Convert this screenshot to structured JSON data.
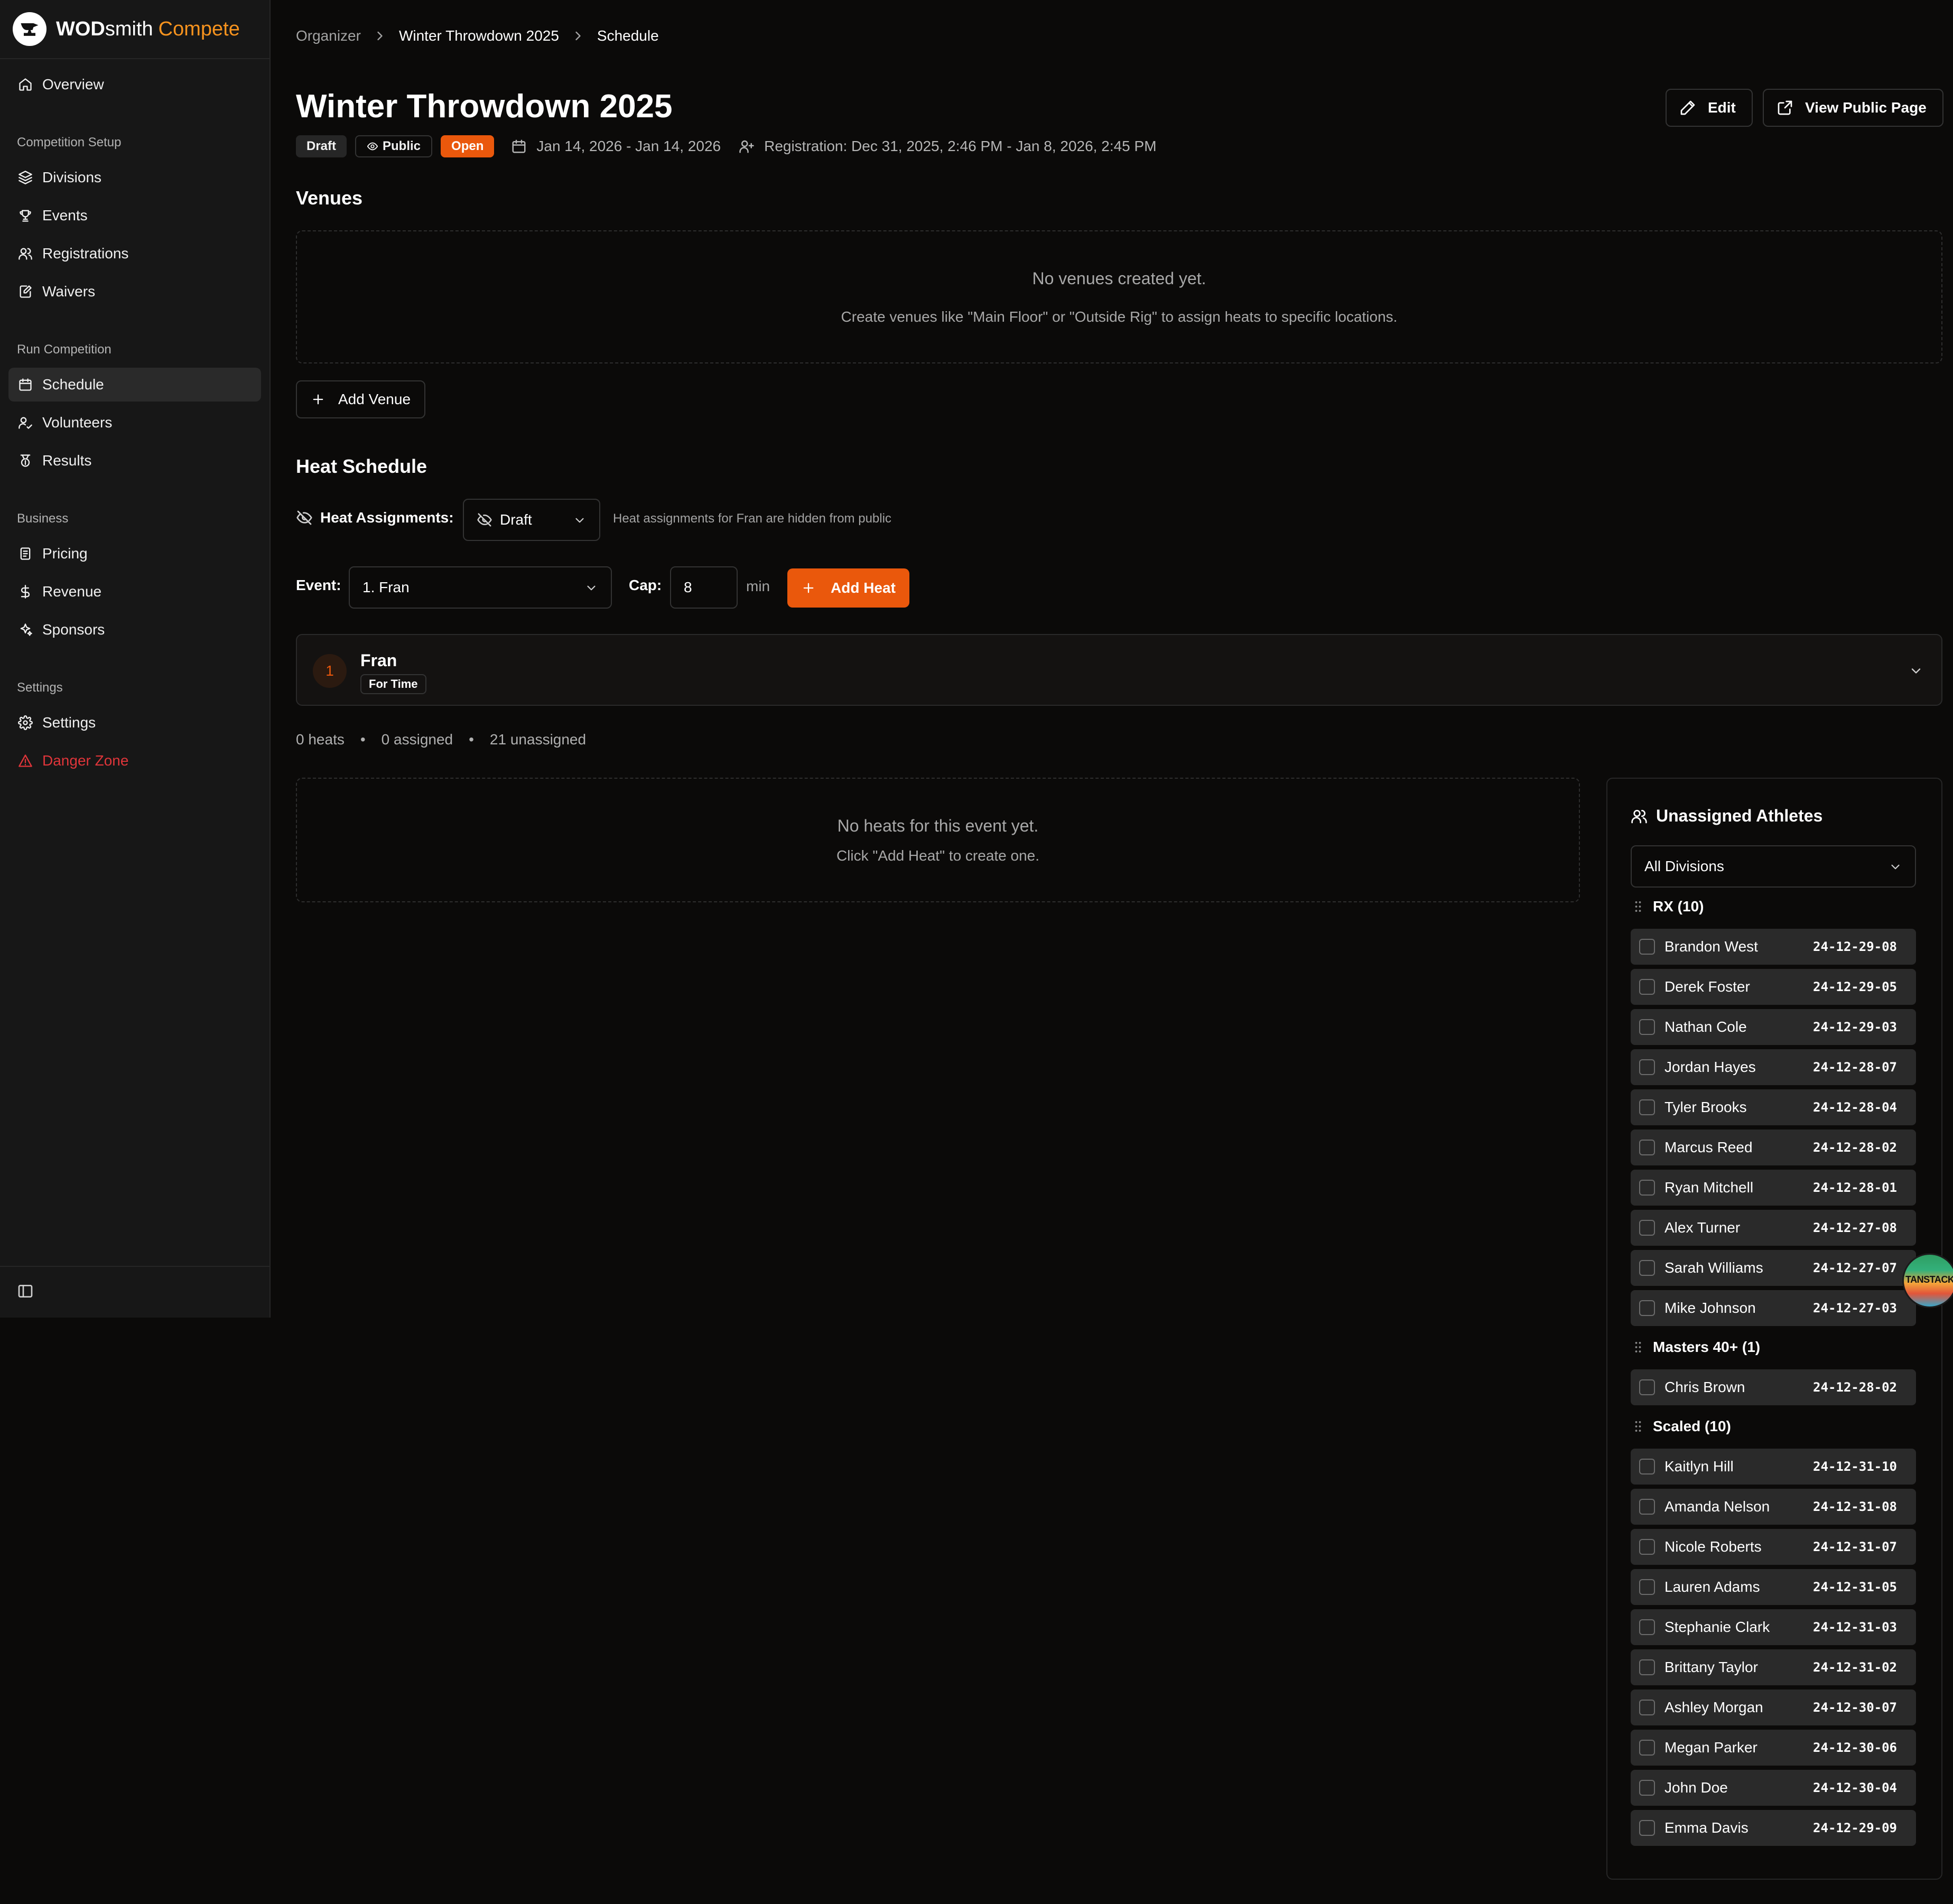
{
  "brand": {
    "name_bold": "WOD",
    "name_light": "smith",
    "name_accent": "Compete"
  },
  "sidebar": {
    "overview": "Overview",
    "sections": {
      "setup": "Competition Setup",
      "run": "Run Competition",
      "business": "Business",
      "settings": "Settings"
    },
    "items": {
      "divisions": "Divisions",
      "events": "Events",
      "registrations": "Registrations",
      "waivers": "Waivers",
      "schedule": "Schedule",
      "volunteers": "Volunteers",
      "results": "Results",
      "pricing": "Pricing",
      "revenue": "Revenue",
      "sponsors": "Sponsors",
      "settings": "Settings",
      "danger": "Danger Zone"
    },
    "active_item": "schedule"
  },
  "breadcrumb": [
    "Organizer",
    "Winter Throwdown 2025",
    "Schedule"
  ],
  "header": {
    "title": "Winter Throwdown 2025",
    "edit_label": "Edit",
    "view_public_label": "View Public Page",
    "badges": {
      "draft": "Draft",
      "public": "Public",
      "open": "Open"
    },
    "dates": "Jan 14, 2026 - Jan 14, 2026",
    "registration": "Registration: Dec 31, 2025, 2:46 PM - Jan 8, 2026, 2:45 PM"
  },
  "venues": {
    "title": "Venues",
    "empty_title": "No venues created yet.",
    "empty_sub": "Create venues like \"Main Floor\" or \"Outside Rig\" to assign heats to specific locations.",
    "add_label": "Add Venue"
  },
  "heat_schedule": {
    "title": "Heat Schedule",
    "assignments_label": "Heat Assignments:",
    "assignments_value": "Draft",
    "assignments_hint": "Heat assignments for Fran are hidden from public",
    "event_label": "Event:",
    "event_value": "1. Fran",
    "cap_label": "Cap:",
    "cap_value": "8",
    "cap_unit": "min",
    "add_heat_label": "Add Heat"
  },
  "event_card": {
    "number": "1",
    "name": "Fran",
    "scheme": "For Time"
  },
  "stats": {
    "heats": "0 heats",
    "assigned": "0 assigned",
    "unassigned": "21 unassigned",
    "separator": "•"
  },
  "heats_empty": {
    "title": "No heats for this event yet.",
    "sub": "Click \"Add Heat\" to create one."
  },
  "unassigned_panel": {
    "title": "Unassigned Athletes",
    "filter_value": "All Divisions",
    "groups": [
      {
        "label": "RX (10)",
        "athletes": [
          {
            "name": "Brandon West",
            "date": "24-12-29-08"
          },
          {
            "name": "Derek Foster",
            "date": "24-12-29-05"
          },
          {
            "name": "Nathan Cole",
            "date": "24-12-29-03"
          },
          {
            "name": "Jordan Hayes",
            "date": "24-12-28-07"
          },
          {
            "name": "Tyler Brooks",
            "date": "24-12-28-04"
          },
          {
            "name": "Marcus Reed",
            "date": "24-12-28-02"
          },
          {
            "name": "Ryan Mitchell",
            "date": "24-12-28-01"
          },
          {
            "name": "Alex Turner",
            "date": "24-12-27-08"
          },
          {
            "name": "Sarah Williams",
            "date": "24-12-27-07"
          },
          {
            "name": "Mike Johnson",
            "date": "24-12-27-03"
          }
        ]
      },
      {
        "label": "Masters 40+ (1)",
        "athletes": [
          {
            "name": "Chris Brown",
            "date": "24-12-28-02"
          }
        ]
      },
      {
        "label": "Scaled (10)",
        "athletes": [
          {
            "name": "Kaitlyn Hill",
            "date": "24-12-31-10"
          },
          {
            "name": "Amanda Nelson",
            "date": "24-12-31-08"
          },
          {
            "name": "Nicole Roberts",
            "date": "24-12-31-07"
          },
          {
            "name": "Lauren Adams",
            "date": "24-12-31-05"
          },
          {
            "name": "Stephanie Clark",
            "date": "24-12-31-03"
          },
          {
            "name": "Brittany Taylor",
            "date": "24-12-31-02"
          },
          {
            "name": "Ashley Morgan",
            "date": "24-12-30-07"
          },
          {
            "name": "Megan Parker",
            "date": "24-12-30-06"
          },
          {
            "name": "John Doe",
            "date": "24-12-30-04"
          },
          {
            "name": "Emma Davis",
            "date": "24-12-29-09"
          }
        ]
      }
    ]
  },
  "devtools_badge": "TANSTACK",
  "colors": {
    "accent": "#ea580c",
    "brand_accent": "#f7931e",
    "danger": "#e0353a",
    "background": "#0b0a09",
    "sidebar": "#171717"
  }
}
